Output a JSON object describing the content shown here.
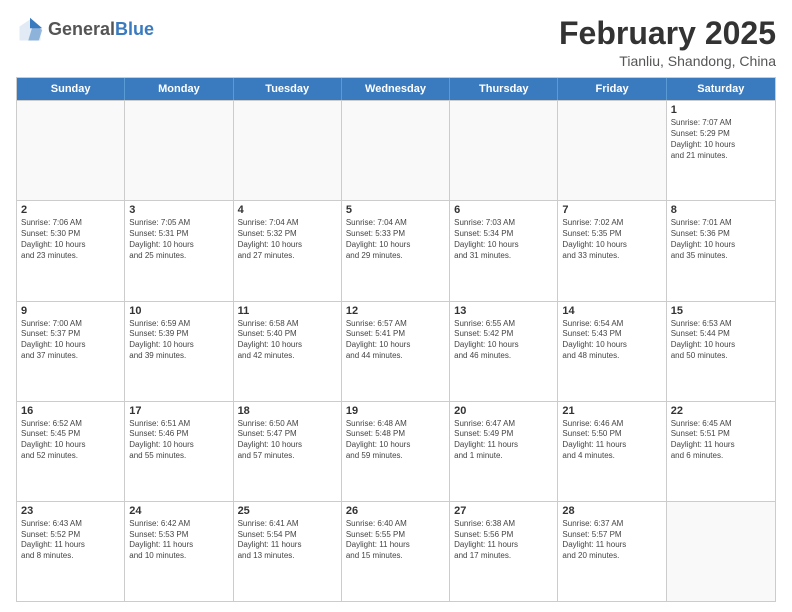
{
  "header": {
    "logo": {
      "general": "General",
      "blue": "Blue"
    },
    "title": "February 2025",
    "location": "Tianliu, Shandong, China"
  },
  "days_of_week": [
    "Sunday",
    "Monday",
    "Tuesday",
    "Wednesday",
    "Thursday",
    "Friday",
    "Saturday"
  ],
  "rows": [
    [
      {
        "day": "",
        "detail": ""
      },
      {
        "day": "",
        "detail": ""
      },
      {
        "day": "",
        "detail": ""
      },
      {
        "day": "",
        "detail": ""
      },
      {
        "day": "",
        "detail": ""
      },
      {
        "day": "",
        "detail": ""
      },
      {
        "day": "1",
        "detail": "Sunrise: 7:07 AM\nSunset: 5:29 PM\nDaylight: 10 hours\nand 21 minutes."
      }
    ],
    [
      {
        "day": "2",
        "detail": "Sunrise: 7:06 AM\nSunset: 5:30 PM\nDaylight: 10 hours\nand 23 minutes."
      },
      {
        "day": "3",
        "detail": "Sunrise: 7:05 AM\nSunset: 5:31 PM\nDaylight: 10 hours\nand 25 minutes."
      },
      {
        "day": "4",
        "detail": "Sunrise: 7:04 AM\nSunset: 5:32 PM\nDaylight: 10 hours\nand 27 minutes."
      },
      {
        "day": "5",
        "detail": "Sunrise: 7:04 AM\nSunset: 5:33 PM\nDaylight: 10 hours\nand 29 minutes."
      },
      {
        "day": "6",
        "detail": "Sunrise: 7:03 AM\nSunset: 5:34 PM\nDaylight: 10 hours\nand 31 minutes."
      },
      {
        "day": "7",
        "detail": "Sunrise: 7:02 AM\nSunset: 5:35 PM\nDaylight: 10 hours\nand 33 minutes."
      },
      {
        "day": "8",
        "detail": "Sunrise: 7:01 AM\nSunset: 5:36 PM\nDaylight: 10 hours\nand 35 minutes."
      }
    ],
    [
      {
        "day": "9",
        "detail": "Sunrise: 7:00 AM\nSunset: 5:37 PM\nDaylight: 10 hours\nand 37 minutes."
      },
      {
        "day": "10",
        "detail": "Sunrise: 6:59 AM\nSunset: 5:39 PM\nDaylight: 10 hours\nand 39 minutes."
      },
      {
        "day": "11",
        "detail": "Sunrise: 6:58 AM\nSunset: 5:40 PM\nDaylight: 10 hours\nand 42 minutes."
      },
      {
        "day": "12",
        "detail": "Sunrise: 6:57 AM\nSunset: 5:41 PM\nDaylight: 10 hours\nand 44 minutes."
      },
      {
        "day": "13",
        "detail": "Sunrise: 6:55 AM\nSunset: 5:42 PM\nDaylight: 10 hours\nand 46 minutes."
      },
      {
        "day": "14",
        "detail": "Sunrise: 6:54 AM\nSunset: 5:43 PM\nDaylight: 10 hours\nand 48 minutes."
      },
      {
        "day": "15",
        "detail": "Sunrise: 6:53 AM\nSunset: 5:44 PM\nDaylight: 10 hours\nand 50 minutes."
      }
    ],
    [
      {
        "day": "16",
        "detail": "Sunrise: 6:52 AM\nSunset: 5:45 PM\nDaylight: 10 hours\nand 52 minutes."
      },
      {
        "day": "17",
        "detail": "Sunrise: 6:51 AM\nSunset: 5:46 PM\nDaylight: 10 hours\nand 55 minutes."
      },
      {
        "day": "18",
        "detail": "Sunrise: 6:50 AM\nSunset: 5:47 PM\nDaylight: 10 hours\nand 57 minutes."
      },
      {
        "day": "19",
        "detail": "Sunrise: 6:48 AM\nSunset: 5:48 PM\nDaylight: 10 hours\nand 59 minutes."
      },
      {
        "day": "20",
        "detail": "Sunrise: 6:47 AM\nSunset: 5:49 PM\nDaylight: 11 hours\nand 1 minute."
      },
      {
        "day": "21",
        "detail": "Sunrise: 6:46 AM\nSunset: 5:50 PM\nDaylight: 11 hours\nand 4 minutes."
      },
      {
        "day": "22",
        "detail": "Sunrise: 6:45 AM\nSunset: 5:51 PM\nDaylight: 11 hours\nand 6 minutes."
      }
    ],
    [
      {
        "day": "23",
        "detail": "Sunrise: 6:43 AM\nSunset: 5:52 PM\nDaylight: 11 hours\nand 8 minutes."
      },
      {
        "day": "24",
        "detail": "Sunrise: 6:42 AM\nSunset: 5:53 PM\nDaylight: 11 hours\nand 10 minutes."
      },
      {
        "day": "25",
        "detail": "Sunrise: 6:41 AM\nSunset: 5:54 PM\nDaylight: 11 hours\nand 13 minutes."
      },
      {
        "day": "26",
        "detail": "Sunrise: 6:40 AM\nSunset: 5:55 PM\nDaylight: 11 hours\nand 15 minutes."
      },
      {
        "day": "27",
        "detail": "Sunrise: 6:38 AM\nSunset: 5:56 PM\nDaylight: 11 hours\nand 17 minutes."
      },
      {
        "day": "28",
        "detail": "Sunrise: 6:37 AM\nSunset: 5:57 PM\nDaylight: 11 hours\nand 20 minutes."
      },
      {
        "day": "",
        "detail": ""
      }
    ]
  ]
}
